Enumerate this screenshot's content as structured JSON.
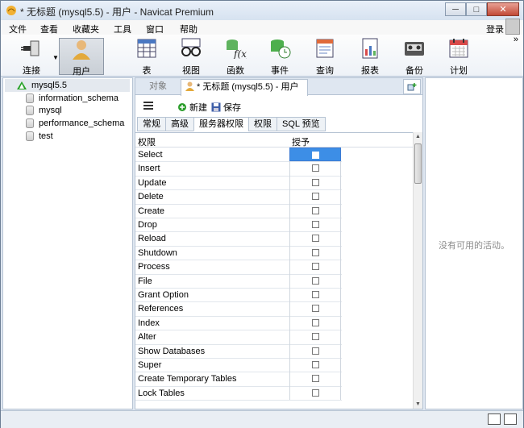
{
  "window": {
    "title": "* 无标题 (mysql5.5) - 用户 - Navicat Premium",
    "min": "─",
    "max": "□",
    "close": "✕"
  },
  "menu": [
    "文件",
    "查看",
    "收藏夹",
    "工具",
    "窗口",
    "帮助"
  ],
  "login": "登录",
  "toolbar": {
    "items": [
      {
        "label": "连接",
        "icon": "plug-icon"
      },
      {
        "label": "用户",
        "icon": "user-icon"
      },
      {
        "label": "表",
        "icon": "table-icon"
      },
      {
        "label": "视图",
        "icon": "glasses-icon"
      },
      {
        "label": "函数",
        "icon": "function-icon"
      },
      {
        "label": "事件",
        "icon": "event-icon"
      },
      {
        "label": "查询",
        "icon": "query-icon"
      },
      {
        "label": "报表",
        "icon": "report-icon"
      },
      {
        "label": "备份",
        "icon": "backup-icon"
      },
      {
        "label": "计划",
        "icon": "calendar-icon"
      }
    ],
    "more": "»"
  },
  "sidebar": {
    "root": "mysql5.5",
    "items": [
      "information_schema",
      "mysql",
      "performance_schema",
      "test"
    ]
  },
  "tabs": {
    "object": "对象",
    "active": "* 无标题 (mysql5.5) - 用户"
  },
  "subtoolbar": {
    "new": "新建",
    "save": "保存"
  },
  "inner_tabs": [
    "常规",
    "高级",
    "服务器权限",
    "权限",
    "SQL 预览"
  ],
  "grid": {
    "col_privilege": "权限",
    "col_grant": "授予",
    "rows": [
      "Select",
      "Insert",
      "Update",
      "Delete",
      "Create",
      "Drop",
      "Reload",
      "Shutdown",
      "Process",
      "File",
      "Grant Option",
      "References",
      "Index",
      "Alter",
      "Show Databases",
      "Super",
      "Create Temporary Tables",
      "Lock Tables"
    ]
  },
  "info": {
    "empty": "没有可用的活动。"
  }
}
